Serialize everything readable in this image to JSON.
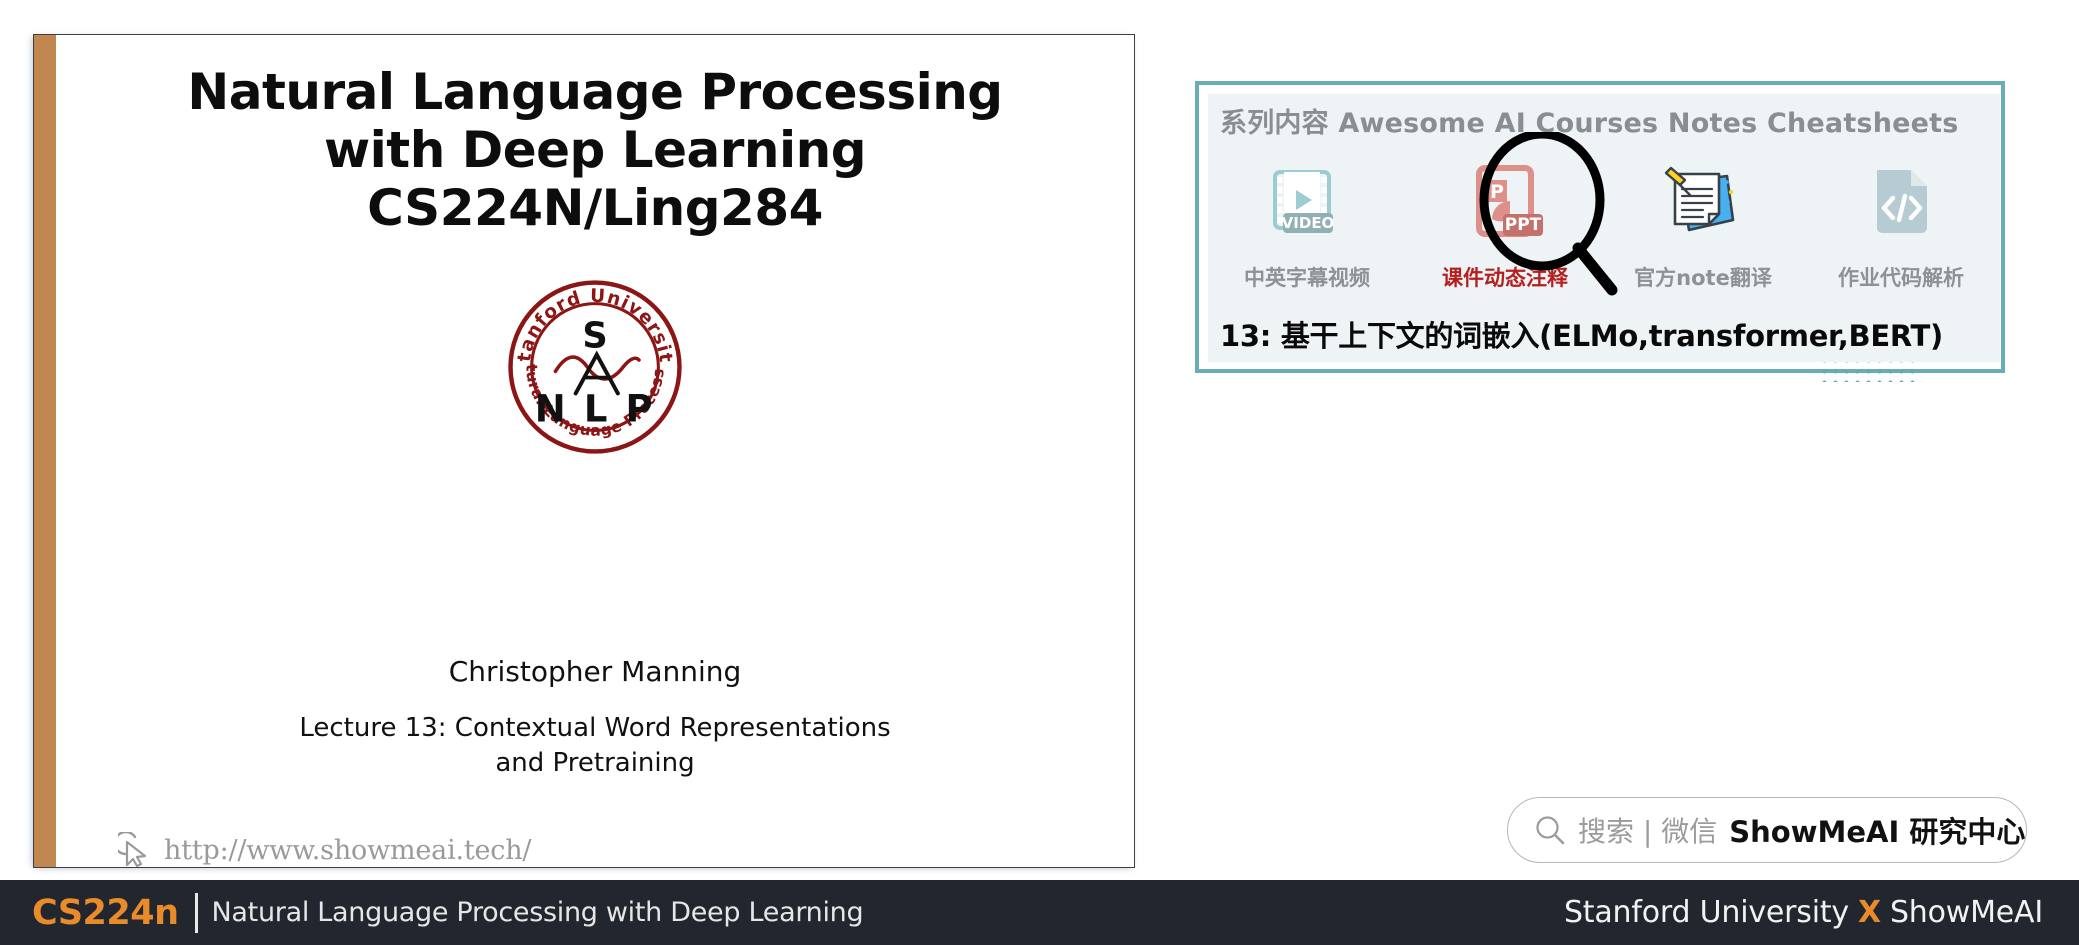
{
  "slide": {
    "title_lines": [
      "Natural Language Processing",
      "with Deep Learning",
      "CS224N/Ling284"
    ],
    "logo": {
      "name": "stanford-nlp-logo",
      "outer_text_top": "Stanford University",
      "outer_text_bottom": "Natural Language Processing",
      "letter_top": "S",
      "letters_bottom": "N L P",
      "color": "#8c1515"
    },
    "author": "Christopher Manning",
    "lecture_lines": [
      "Lecture 13: Contextual Word Representations",
      "and Pretraining"
    ],
    "url": "http://www.showmeai.tech/",
    "cursor_icon": "cursor-pointer-icon",
    "accent_color": "#c08751"
  },
  "promo": {
    "heading": "系列内容 Awesome AI Courses Notes Cheatsheets",
    "border_color": "#69aeb6",
    "background_color": "#eef4f6",
    "items": [
      {
        "icon": "video-film-icon",
        "badge": "VIDEO",
        "label": "中英字幕视频",
        "highlighted": false
      },
      {
        "icon": "ppt-file-icon",
        "badge": "PPT",
        "letter": "P",
        "label": "课件动态注释",
        "highlighted": true
      },
      {
        "icon": "note-pinned-icon",
        "badge": "",
        "label": "官方note翻译",
        "highlighted": false
      },
      {
        "icon": "code-file-icon",
        "badge": "</>",
        "label": "作业代码解析",
        "highlighted": false
      }
    ],
    "highlight_color": "#b51f1f",
    "magnifier_icon": "magnifier-icon",
    "subtitle": "13: 基干上下文的词嵌入(ELMo,transformer,BERT)"
  },
  "search": {
    "icon": "search-icon",
    "placeholder": "搜索 | 微信",
    "brand": "ShowMeAI 研究中心"
  },
  "footer": {
    "course": "CS224n",
    "subtitle": "Natural Language Processing with Deep Learning",
    "right_left": "Stanford University",
    "right_x": "X",
    "right_right": "ShowMeAI",
    "background": "#22262f",
    "accent": "#e98a2b"
  }
}
